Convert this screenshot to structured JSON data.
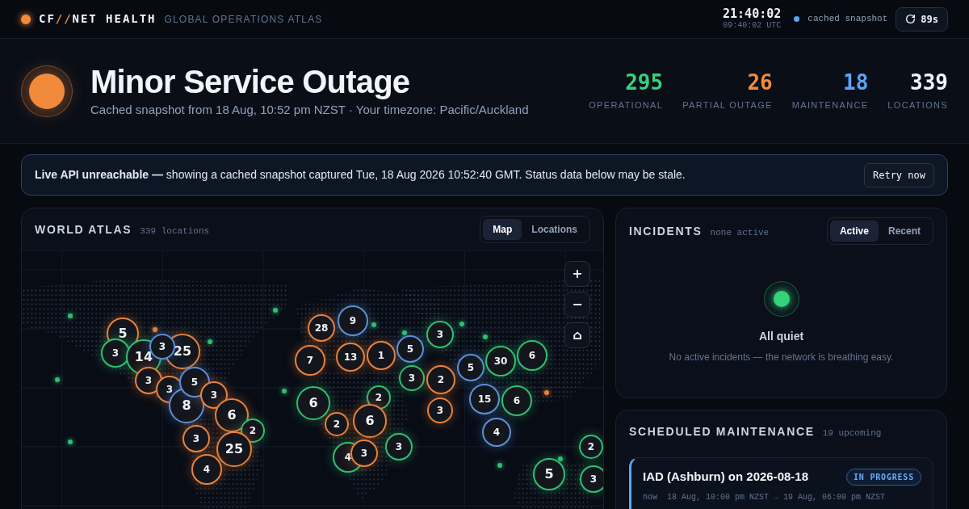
{
  "header": {
    "brand": {
      "prefix": "CF",
      "separator": "//",
      "name": "NET HEALTH"
    },
    "subtitle": "GLOBAL OPERATIONS ATLAS",
    "clock": "21:40:02",
    "utc": "09:40:02 UTC",
    "mode": "cached snapshot",
    "refresh": "89s"
  },
  "hero": {
    "kind": "partial",
    "title": "Minor Service Outage",
    "subtitle": "Cached snapshot from 18 Aug, 10:52 pm NZST · Your timezone: Pacific/Auckland",
    "stats": [
      {
        "kind": "operational",
        "value": "295",
        "label": "OPERATIONAL"
      },
      {
        "kind": "partial",
        "value": "26",
        "label": "PARTIAL OUTAGE"
      },
      {
        "kind": "maintenance",
        "value": "18",
        "label": "MAINTENANCE"
      },
      {
        "kind": "total",
        "value": "339",
        "label": "LOCATIONS"
      }
    ]
  },
  "banner": {
    "text": "**Live API unreachable —** showing a cached snapshot captured Tue, 18 Aug 2026 10:52:40 GMT. Status data below may be stale.",
    "button": "Retry now"
  },
  "atlas": {
    "title": "WORLD ATLAS",
    "count": "339 locations",
    "tabs": [
      {
        "label": "Map",
        "selected": true
      },
      {
        "label": "Locations",
        "selected": false
      }
    ],
    "controls": [
      "+",
      "−",
      "⌂"
    ],
    "markers": [
      {
        "label": "5",
        "color": "#e8813a"
      },
      {
        "label": "3",
        "color": "#2fbf71"
      },
      {
        "label": "14",
        "color": "#2fbf71"
      },
      {
        "label": "3",
        "color": "#5b8fd6"
      },
      {
        "label": "25",
        "color": "#e8813a"
      },
      {
        "label": "3",
        "color": "#e8813a"
      },
      {
        "label": "3",
        "color": "#e8813a"
      },
      {
        "label": "8",
        "color": "#5b8fd6"
      },
      {
        "label": "5",
        "color": "#5b8fd6"
      },
      {
        "label": "3",
        "color": "#e8813a"
      },
      {
        "label": "6",
        "color": "#e8813a"
      },
      {
        "label": "2",
        "color": "#2fbf71"
      },
      {
        "label": "3",
        "color": "#e8813a"
      },
      {
        "label": "25",
        "color": "#e8813a"
      },
      {
        "label": "4",
        "color": "#e8813a"
      },
      {
        "label": "28",
        "color": "#e8813a"
      },
      {
        "label": "9",
        "color": "#5b8fd6"
      },
      {
        "label": "13",
        "color": "#e8813a"
      },
      {
        "label": "7",
        "color": "#e8813a"
      },
      {
        "label": "1",
        "color": "#e8813a"
      },
      {
        "label": "5",
        "color": "#5b8fd6"
      },
      {
        "label": "3",
        "color": "#2fbf71"
      },
      {
        "label": "3",
        "color": "#2fbf71"
      },
      {
        "label": "6",
        "color": "#2fbf71"
      },
      {
        "label": "2",
        "color": "#2fbf71"
      },
      {
        "label": "2",
        "color": "#e8813a"
      },
      {
        "label": "6",
        "color": "#e8813a"
      },
      {
        "label": "4",
        "color": "#2fbf71"
      },
      {
        "label": "3",
        "color": "#e8813a"
      },
      {
        "label": "3",
        "color": "#2fbf71"
      },
      {
        "label": "2",
        "color": "#e8813a"
      },
      {
        "label": "3",
        "color": "#e8813a"
      },
      {
        "label": "15",
        "color": "#5b8fd6"
      },
      {
        "label": "5",
        "color": "#5b8fd6"
      },
      {
        "label": "30",
        "color": "#2fbf71"
      },
      {
        "label": "6",
        "color": "#2fbf71"
      },
      {
        "label": "6",
        "color": "#2fbf71"
      },
      {
        "label": "4",
        "color": "#5b8fd6"
      },
      {
        "label": "2",
        "color": "#2fbf71"
      },
      {
        "label": "5",
        "color": "#2fbf71"
      },
      {
        "label": "3",
        "color": "#2fbf71"
      }
    ],
    "dots": [
      {
        "color": "#2fbf71"
      },
      {
        "color": "#2fbf71"
      },
      {
        "color": "#2fbf71"
      },
      {
        "color": "#2fbf71"
      },
      {
        "color": "#2fbf71"
      },
      {
        "color": "#2fbf71"
      },
      {
        "color": "#2fbf71"
      },
      {
        "color": "#2fbf71"
      },
      {
        "color": "#2fbf71"
      },
      {
        "color": "#2fbf71"
      },
      {
        "color": "#2fbf71"
      },
      {
        "color": "#2fbf71"
      },
      {
        "color": "#e8813a"
      },
      {
        "color": "#e8813a"
      }
    ]
  },
  "incidents": {
    "title": "INCIDENTS",
    "note": "none active",
    "tabs": [
      {
        "label": "Active",
        "selected": true
      },
      {
        "label": "Recent",
        "selected": false
      }
    ],
    "empty": {
      "title": "All quiet",
      "text": "No active incidents — the network is breathing easy."
    }
  },
  "maintenance": {
    "title": "SCHEDULED MAINTENANCE",
    "note": "19 upcoming",
    "items": [
      {
        "title": "IAD (Ashburn) on 2026-08-18",
        "badge": "IN PROGRESS",
        "when": "now",
        "range": "18 Aug, 10:00 pm NZST → 19 Aug, 06:00 pm NZST"
      }
    ]
  }
}
